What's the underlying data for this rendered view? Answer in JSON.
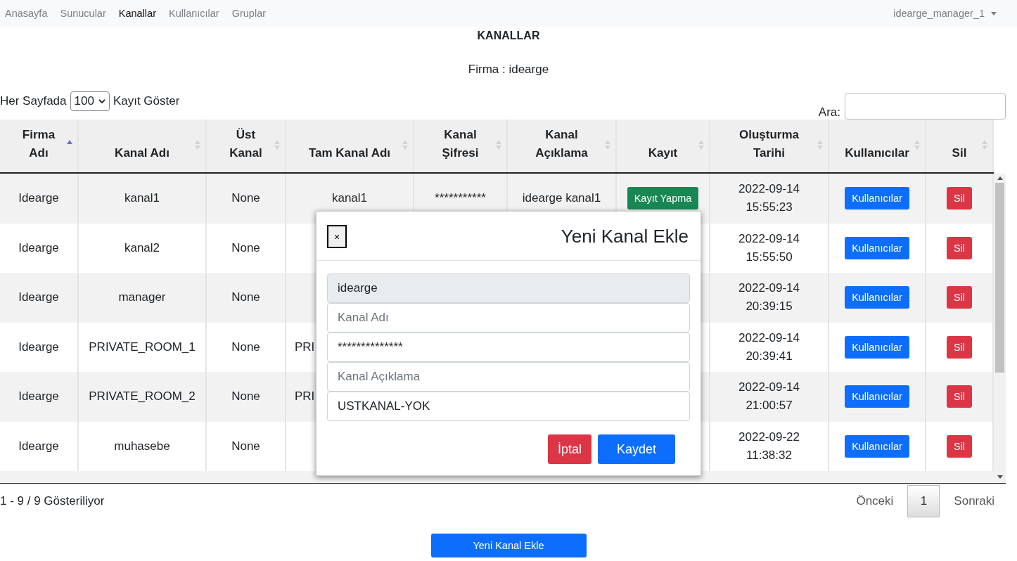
{
  "nav": {
    "items": [
      {
        "label": "Anasayfa",
        "selected": false
      },
      {
        "label": "Sunucular",
        "selected": false
      },
      {
        "label": "Kanallar",
        "selected": true
      },
      {
        "label": "Kullanıcılar",
        "selected": false
      },
      {
        "label": "Gruplar",
        "selected": false
      }
    ],
    "user": "idearge_manager_1"
  },
  "page_title": "KANALLAR",
  "company": "Firma : idearge",
  "length_control": {
    "before": "Her Sayfada",
    "value": "100",
    "after": "Kayıt Göster"
  },
  "search": {
    "label": "Ara:"
  },
  "table": {
    "columns": [
      {
        "label": "Firma\nAdı",
        "sorted": true
      },
      {
        "label": "Kanal Adı",
        "sorted": false
      },
      {
        "label": "Üst\nKanal",
        "sorted": false
      },
      {
        "label": "Tam Kanal Adı",
        "sorted": false
      },
      {
        "label": "Kanal\nŞifresi",
        "sorted": false
      },
      {
        "label": "Kanal\nAçıklama",
        "sorted": false
      },
      {
        "label": "Kayıt",
        "sorted": false
      },
      {
        "label": "Oluşturma\nTarihi",
        "sorted": false
      },
      {
        "label": "Kullanıcılar",
        "sorted": false
      },
      {
        "label": "Sil",
        "sorted": false
      }
    ],
    "rows": [
      {
        "company": "Idearge",
        "name": "kanal1",
        "parent": "None",
        "full_name": "kanal1",
        "password": "***********",
        "description": "idearge kanal1",
        "record": "Kayıt Yapma",
        "created": "2022-09-14 15:55:23",
        "users": "Kullanıcılar",
        "delete": "Sil"
      },
      {
        "company": "Idearge",
        "name": "kanal2",
        "parent": "None",
        "created": "2022-09-14 15:55:50",
        "users": "Kullanıcılar",
        "delete": "Sil"
      },
      {
        "company": "Idearge",
        "name": "manager",
        "parent": "None",
        "created": "2022-09-14 20:39:15",
        "users": "Kullanıcılar",
        "delete": "Sil"
      },
      {
        "company": "Idearge",
        "name": "PRIVATE_ROOM_1",
        "parent": "None",
        "full_name": "PRI",
        "created": "2022-09-14 20:39:41",
        "users": "Kullanıcılar",
        "delete": "Sil"
      },
      {
        "company": "Idearge",
        "name": "PRIVATE_ROOM_2",
        "parent": "None",
        "full_name": "PRI",
        "created": "2022-09-14 21:00:57",
        "users": "Kullanıcılar",
        "delete": "Sil"
      },
      {
        "company": "Idearge",
        "name": "muhasebe",
        "parent": "None",
        "created": "2022-09-22 11:38:32",
        "users": "Kullanıcılar",
        "delete": "Sil"
      }
    ]
  },
  "info": "1 - 9 / 9 Gösteriliyor",
  "pagination": {
    "previous": "Önceki",
    "pages": [
      {
        "label": "1",
        "selected": true
      }
    ],
    "next": "Sonraki"
  },
  "add_button": "Yeni Kanal Ekle",
  "modal": {
    "close": "×",
    "title": "Yeni Kanal Ekle",
    "fields": [
      {
        "value": "idearge",
        "disabled": true
      },
      {
        "placeholder": "Kanal Adı",
        "disabled": false
      },
      {
        "value": "**************",
        "disabled": false
      },
      {
        "placeholder": "Kanal Açıklama",
        "disabled": false
      },
      {
        "value": "USTKANAL-YOK",
        "disabled": false
      }
    ],
    "cancel": "İptal",
    "save": "Kaydet"
  }
}
